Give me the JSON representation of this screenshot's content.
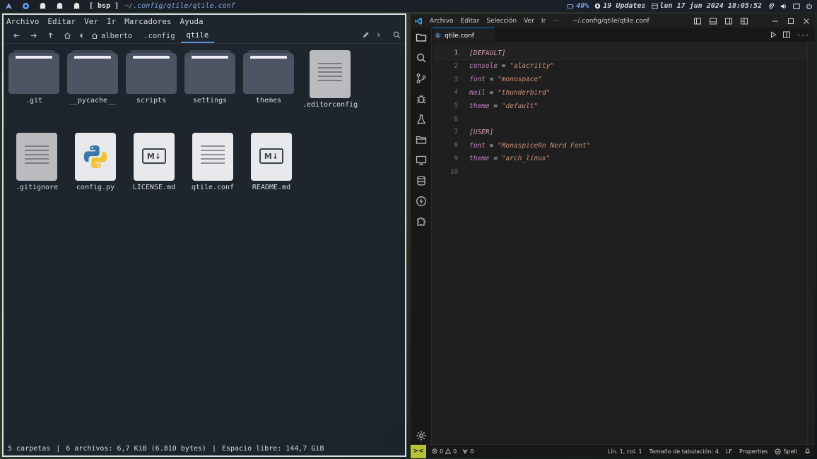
{
  "topbar": {
    "layout": "[ bsp ]",
    "window_title": "~/.config/qtile/qtile.conf",
    "battery": "40%",
    "updates": "19 Updates",
    "datetime": "lun 17 jun 2024 18:05:52"
  },
  "filemanager": {
    "menu": [
      "Archivo",
      "Editar",
      "Ver",
      "Ir",
      "Marcadores",
      "Ayuda"
    ],
    "breadcrumbs": [
      "alberto",
      ".config",
      "qtile"
    ],
    "items": [
      {
        "name": ".git",
        "kind": "folder"
      },
      {
        "name": "__pycache__",
        "kind": "folder"
      },
      {
        "name": "scripts",
        "kind": "folder"
      },
      {
        "name": "settings",
        "kind": "folder"
      },
      {
        "name": "themes",
        "kind": "folder"
      },
      {
        "name": ".editorconfig",
        "kind": "text-grey"
      },
      {
        "name": ".gitignore",
        "kind": "text-grey"
      },
      {
        "name": "config.py",
        "kind": "python"
      },
      {
        "name": "LICENSE.md",
        "kind": "markdown"
      },
      {
        "name": "qtile.conf",
        "kind": "text"
      },
      {
        "name": "README.md",
        "kind": "markdown"
      }
    ],
    "status": {
      "folders": "5 carpetas",
      "files": "6 archivos: 6,7 KiB (6.810 bytes)",
      "free": "Espacio libre: 144,7 GiB",
      "separator": "|"
    }
  },
  "vscode": {
    "menu": [
      "Archivo",
      "Editar",
      "Selección",
      "Ver",
      "Ir",
      "···"
    ],
    "title": "~/.config/qtile/qtile.conf",
    "tab": "qtile.conf",
    "md_badge": "M↓",
    "lines": [
      {
        "n": "1",
        "type": "section",
        "text": "[DEFAULT]"
      },
      {
        "n": "2",
        "type": "pair",
        "key": "console",
        "value": "\"alacritty\""
      },
      {
        "n": "3",
        "type": "pair",
        "key": "font",
        "value": "\"monospace\""
      },
      {
        "n": "4",
        "type": "pair",
        "key": "mail",
        "value": "\"thunderbird\""
      },
      {
        "n": "5",
        "type": "pair",
        "key": "theme",
        "value": "\"default\""
      },
      {
        "n": "6",
        "type": "blank"
      },
      {
        "n": "7",
        "type": "section",
        "text": "[USER]"
      },
      {
        "n": "8",
        "type": "pair",
        "key": "font",
        "value": "\"MonaspiceRn Nerd Font\""
      },
      {
        "n": "9",
        "type": "pair",
        "key": "theme",
        "value": "\"arch_linux\""
      },
      {
        "n": "10",
        "type": "blank"
      }
    ],
    "status": {
      "remote": "><",
      "errors": "0",
      "warnings": "0",
      "ports": "0",
      "position": "Lín. 1, col. 1",
      "tab_size": "Tamaño de tabulación: 4",
      "eol": "LF",
      "language": "Properties",
      "spell": "Spell"
    }
  },
  "colors": {
    "accent": "#0078d4",
    "remote_badge": "#b7c334",
    "topbar_bg": "#1b1f27"
  }
}
